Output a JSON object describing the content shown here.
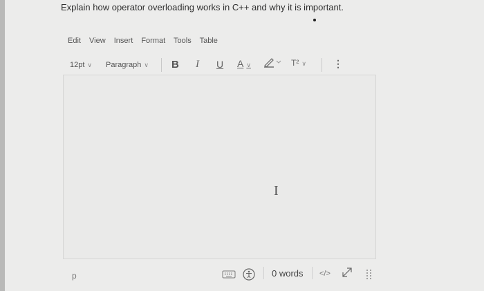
{
  "question": "Explain how operator overloading works in C++ and why it is important.",
  "menubar": {
    "items": [
      "Edit",
      "View",
      "Insert",
      "Format",
      "Tools",
      "Table"
    ]
  },
  "toolbar": {
    "font_size": "12pt",
    "block_format": "Paragraph",
    "bold": "B",
    "italic": "I",
    "underline": "U",
    "text_color": "A",
    "superscript": "T²",
    "more": "⋮"
  },
  "statusbar": {
    "path": "p",
    "word_count": "0 words",
    "code_view": "</>"
  },
  "icons": [
    "keyboard-icon",
    "accessibility-icon",
    "expand-icon",
    "resize-grip-icon",
    "highlighter-icon",
    "text-cursor-icon"
  ]
}
